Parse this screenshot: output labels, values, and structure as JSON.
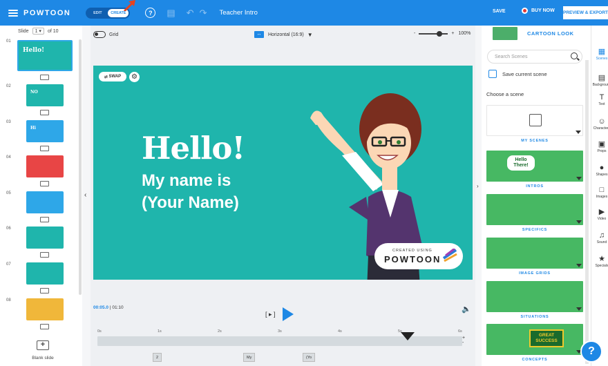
{
  "topbar": {
    "logo": "POWTOON",
    "mode_edit": "EDIT",
    "mode_create": "CREATE",
    "help": "?",
    "doc_title": "Teacher Intro",
    "save": "SAVE",
    "buy_now": "BUY NOW",
    "preview_export": "PREVIEW & EXPORT"
  },
  "slides_panel": {
    "slide_label": "Slide",
    "current_slide": "1",
    "total": "of 10",
    "blank_slide": "Blank slide",
    "items": [
      {
        "num": "01",
        "color": "#1fb5ac",
        "text": "Hello!"
      },
      {
        "num": "02",
        "color": "#1fb5ac",
        "text": "NO"
      },
      {
        "num": "03",
        "color": "#2ea7e8",
        "text": "Hi"
      },
      {
        "num": "04",
        "color": "#e84545",
        "text": ""
      },
      {
        "num": "05",
        "color": "#2ea7e8",
        "text": ""
      },
      {
        "num": "06",
        "color": "#1fb5ac",
        "text": ""
      },
      {
        "num": "07",
        "color": "#1fb5ac",
        "text": ""
      },
      {
        "num": "08",
        "color": "#f0b73a",
        "text": ""
      }
    ]
  },
  "canvas_toolbar": {
    "grid": "Grid",
    "orientation": "Horizontal (16:9)",
    "zoom_minus": "-",
    "zoom_plus": "+",
    "zoom_value": "100%"
  },
  "stage": {
    "swap": "SWAP",
    "hello": "Hello!",
    "line1": "My name is",
    "line2": "(Your Name)",
    "badge_small": "CREATED USING",
    "badge_big": "POWTOON"
  },
  "player": {
    "current_time": "00:05.0",
    "total_time": "01:10",
    "step": "[ ▸ ]",
    "ticks": [
      "0s",
      "1s",
      "2s",
      "3s",
      "4s",
      "5s",
      "6s"
    ],
    "labels": [
      "2",
      "My",
      "(Yo"
    ],
    "playhead_fraction": 0.86
  },
  "library": {
    "look_title": "CARTOON LOOK",
    "search_placeholder": "Search Scenes",
    "save_scene": "Save current scene",
    "choose_scene": "Choose a scene",
    "categories": [
      {
        "label": "MY SCENES",
        "color": "#ffffff"
      },
      {
        "label": "INTROS",
        "color": "#47b863"
      },
      {
        "label": "SPECIFICS",
        "color": "#47b863"
      },
      {
        "label": "IMAGE GRIDS",
        "color": "#47b863"
      },
      {
        "label": "SITUATIONS",
        "color": "#47b863"
      },
      {
        "label": "CONCEPTS",
        "color": "#47b863"
      }
    ],
    "intro_bubble": "Hello There!",
    "concept_sign": "GREAT SUCCESS"
  },
  "icon_bar": {
    "items": [
      {
        "label": "Scenes",
        "icon": "scenes-icon"
      },
      {
        "label": "Background",
        "icon": "background-icon"
      },
      {
        "label": "Text",
        "icon": "text-icon"
      },
      {
        "label": "Characters",
        "icon": "characters-icon"
      },
      {
        "label": "Props",
        "icon": "props-icon"
      },
      {
        "label": "Shapes",
        "icon": "shapes-icon"
      },
      {
        "label": "Images",
        "icon": "images-icon"
      },
      {
        "label": "Video",
        "icon": "video-icon"
      },
      {
        "label": "Sound",
        "icon": "sound-icon"
      },
      {
        "label": "Specials",
        "icon": "specials-icon"
      }
    ]
  },
  "help_fab": "?"
}
